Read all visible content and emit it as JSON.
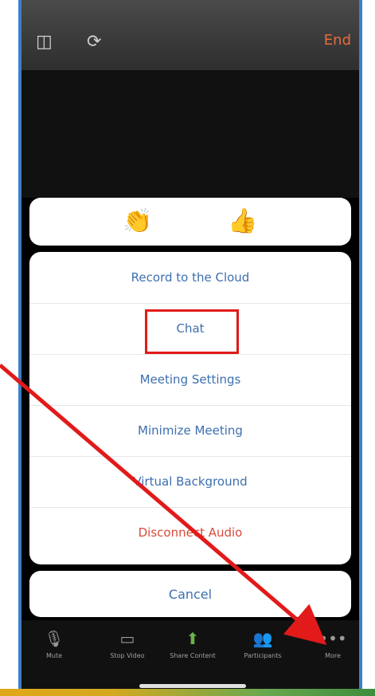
{
  "top_bar": {
    "speaker_icon": "speaker-icon",
    "camera_icon": "camera-switch-icon",
    "leave_label": "End"
  },
  "reactions": [
    {
      "name": "clap-icon",
      "glyph": "👏"
    },
    {
      "name": "thumbs-up-icon",
      "glyph": "👍"
    }
  ],
  "menu": {
    "items": [
      {
        "label": "Record to the Cloud"
      },
      {
        "label": "Chat"
      },
      {
        "label": "Meeting Settings"
      },
      {
        "label": "Minimize Meeting"
      },
      {
        "label": "Virtual Background"
      },
      {
        "label": "Disconnect Audio"
      }
    ]
  },
  "cancel_label": "Cancel",
  "toolbar": [
    {
      "label": "Mute",
      "icon": "microphone-icon",
      "glyph": "🎙"
    },
    {
      "label": "Stop Video",
      "icon": "video-icon",
      "glyph": "▭"
    },
    {
      "label": "Share Content",
      "icon": "share-icon",
      "glyph": "⬆"
    },
    {
      "label": "Participants",
      "icon": "participants-icon",
      "glyph": "👥"
    },
    {
      "label": "More",
      "icon": "more-icon",
      "glyph": "•••"
    }
  ],
  "colors": {
    "highlight": "#e21a1a",
    "menu_text": "#3d6fb0",
    "danger_text": "#d64a3a",
    "phone_border": "#3d7fc7"
  }
}
